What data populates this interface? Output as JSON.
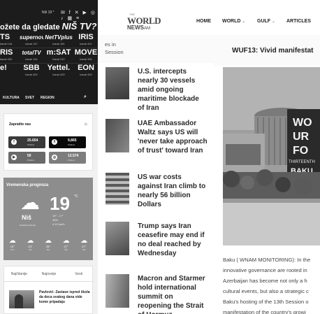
{
  "left_portal": {
    "top_bar": {
      "temperature": "Niš 19 °",
      "social_icons": "✉ f ✕ ▶ ◎ ♪ ▦ ≡"
    },
    "promo": {
      "headline": "ožete da gledate",
      "brand": "NIŠ TV?",
      "channels": [
        [
          {
            "name": "TS",
            "sub": "kanal 144"
          },
          {
            "name": "supernova",
            "sub": "kanal 147"
          },
          {
            "name": "NetTVplus",
            "sub": "kanal 181"
          },
          {
            "name": "IRIS",
            "sub": "kanal 421"
          }
        ],
        [
          {
            "name": "RIS",
            "sub": "kanal 420"
          },
          {
            "name": "totalTV",
            "sub": "kanal 144"
          },
          {
            "name": "m:SAT",
            "sub": "kanal 210"
          },
          {
            "name": "MOVE",
            "sub": "kanal 334"
          }
        ],
        [
          {
            "name": "e!",
            "sub": ""
          },
          {
            "name": "SBB",
            "sub": "kanal 429"
          },
          {
            "name": "Yettel.",
            "sub": "kanal 429"
          },
          {
            "name": "EON",
            "sub": "kanal 429"
          }
        ]
      ]
    },
    "nav": [
      "KULTURA",
      "SVET",
      "REGION"
    ],
    "follow": {
      "title": "Zapratite nas",
      "tiles": [
        {
          "icon": "f",
          "count": "25.654",
          "label": "Pratioci",
          "color": "#3a3a3a"
        },
        {
          "icon": "X",
          "count": "9,865",
          "label": "Pratioci",
          "color": "#0a0a0a"
        },
        {
          "icon": "▶",
          "count": "50",
          "label": "Pratioci",
          "color": "#6a6a6a"
        },
        {
          "icon": "◎",
          "count": "13.574",
          "label": "Pratioci",
          "color": "#7d7d7d"
        }
      ]
    },
    "weather": {
      "title": "Vremenska prognoza",
      "temp": "19",
      "unit": "°C",
      "city": "Niš",
      "condition": "Scattered Clouds",
      "details": [
        "19° - 17°",
        "46%",
        "4.12 km/h"
      ],
      "forecast": [
        {
          "t": "19°",
          "d": "Pon"
        },
        {
          "t": "23°",
          "d": "Uto"
        },
        {
          "t": "25°",
          "d": "Sre"
        },
        {
          "t": "27°",
          "d": "Čet"
        },
        {
          "t": "27°",
          "d": "Pet"
        }
      ]
    },
    "tabs": {
      "labels": [
        "Najčitanije",
        "Najnovije",
        "Vesti"
      ],
      "article": "Pavlović: Zastave ispred škola da deca svakog dana vide kome pripadaju"
    }
  },
  "wnam": {
    "logo": {
      "top": "THE",
      "word": "WORLD",
      "news": "NEWS",
      "am": "AM"
    },
    "nav": [
      "HOME",
      "WORLD",
      "GULF",
      "ARTICLES"
    ],
    "sub_left": "es in\nSession",
    "article_title": "WUF13: Vivid manifestat",
    "feed": [
      "U.S. intercepts nearly 30 vessels amid ongoing maritime blockade of Iran",
      "UAE Ambassador Waltz says US will 'never take approach of trust' toward Iran",
      "US war costs against Iran climb to nearly 56 billion Dollars",
      "Trump says Iran ceasefire may end if no deal reached by Wednesday",
      "Macron and Starmer hold international summit on reopening the Strait of Hormuz"
    ],
    "photo_sign": [
      "WO",
      "UR",
      "FO",
      "THIRTEENTH",
      "BAKU"
    ],
    "body_lines": [
      "Baku ( WNAM MONITORING): In the",
      "innovative governance are rooted in",
      "Azerbaijan has become not only a h",
      "cultural events, but also a strategic c",
      "Baku's hosting of the 13th Session o",
      "manifestation of the country's growi"
    ]
  }
}
